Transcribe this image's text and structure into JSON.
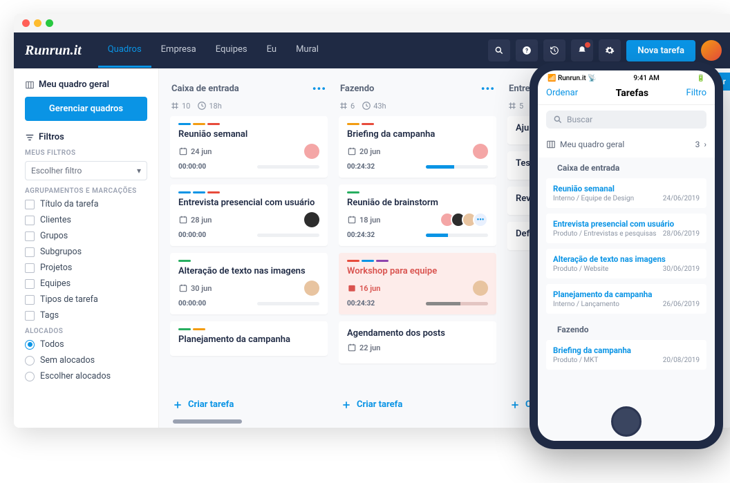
{
  "brand": "Runrun.it",
  "nav": {
    "items": [
      "Quadros",
      "Empresa",
      "Equipes",
      "Eu",
      "Mural"
    ],
    "active": 0,
    "new_task": "Nova tarefa"
  },
  "sidebar": {
    "board_title": "Meu quadro geral",
    "manage": "Gerenciar quadros",
    "filters_label": "Filtros",
    "my_filters_label": "MEUS FILTROS",
    "filter_placeholder": "Escolher filtro",
    "groups_label": "AGRUPAMENTOS E MARCAÇÕES",
    "group_items": [
      "Título da tarefa",
      "Clientes",
      "Grupos",
      "Subgrupos",
      "Projetos",
      "Equipes",
      "Tipos de tarefa",
      "Tags"
    ],
    "alloc_label": "ALOCADOS",
    "alloc_items": [
      "Todos",
      "Sem alocados",
      "Escolher alocados"
    ],
    "alloc_active": 0
  },
  "board": {
    "create_label": "Criar tarefa",
    "create_top": "Criar r",
    "columns": [
      {
        "title": "Caixa de entrada",
        "count": 10,
        "hours": "18h",
        "cards": [
          {
            "tags": [
              "#0a94e5",
              "#f39c12",
              "#e74c3c"
            ],
            "title": "Reunião semanal",
            "date": "24 jun",
            "time": "00:00:00",
            "progress": 0,
            "avatars": 1
          },
          {
            "tags": [
              "#0a94e5",
              "#0a94e5",
              "#e74c3c"
            ],
            "title": "Entrevista presencial com usuário",
            "date": "28 jun",
            "time": "00:00:00",
            "progress": 0,
            "avatars": 1
          },
          {
            "tags": [
              "#27ae60"
            ],
            "title": "Alteração de texto nas imagens",
            "date": "30 jun",
            "time": "00:00:00",
            "progress": 0,
            "avatars": 1
          },
          {
            "tags": [
              "#27ae60",
              "#f39c12"
            ],
            "title": "Planejamento da campanha",
            "date": "",
            "time": "",
            "progress": 0,
            "avatars": 0
          }
        ]
      },
      {
        "title": "Fazendo",
        "count": 6,
        "hours": "43h",
        "cards": [
          {
            "tags": [
              "#f39c12",
              "#e74c3c"
            ],
            "title": "Briefing da campanha",
            "date": "20 jun",
            "time": "00:24:32",
            "progress": 45,
            "avatars": 1
          },
          {
            "tags": [
              "#27ae60"
            ],
            "title": "Reunião de brainstorm",
            "date": "18 jun",
            "time": "00:24:32",
            "progress": 35,
            "avatars": 4
          },
          {
            "tags": [
              "#e74c3c",
              "#0a94e5",
              "#8e44ad"
            ],
            "title": "Workshop para equipe",
            "date": "16 jun",
            "time": "00:24:32",
            "progress": 55,
            "avatars": 1,
            "urgent": true
          },
          {
            "tags": [],
            "title": "Agendamento dos posts",
            "date": "22 jun",
            "time": "",
            "progress": 0,
            "avatars": 0
          }
        ]
      },
      {
        "title": "Entre",
        "count": 5,
        "hours": "",
        "cards": [
          {
            "tags": [],
            "title": "Aju",
            "date": "",
            "time": "",
            "progress": 0,
            "avatars": 0
          },
          {
            "tags": [],
            "title": "Tes",
            "date": "",
            "time": "",
            "progress": 0,
            "avatars": 0
          },
          {
            "tags": [],
            "title": "Rev",
            "date": "",
            "time": "",
            "progress": 0,
            "avatars": 0
          },
          {
            "tags": [],
            "title": "Def",
            "date": "",
            "time": "",
            "progress": 0,
            "avatars": 0
          }
        ]
      }
    ]
  },
  "phone": {
    "carrier": "Runrun.it",
    "time": "9:41 AM",
    "nav": {
      "left": "Ordenar",
      "title": "Tarefas",
      "right": "Filtro"
    },
    "search_placeholder": "Buscar",
    "board_name": "Meu quadro geral",
    "board_count": "3",
    "sections": [
      {
        "title": "Caixa de entrada",
        "tasks": [
          {
            "title": "Reunião semanal",
            "meta": "Interno / Equipe de Design",
            "date": "24/06/2019"
          },
          {
            "title": "Entrevista presencial com usuário",
            "meta": "Produto / Entrevistas e pesquisas",
            "date": "28/06/2019"
          },
          {
            "title": "Alteração de texto nas imagens",
            "meta": "Produto / Website",
            "date": "30/06/2019"
          },
          {
            "title": "Planejamento da campanha",
            "meta": "Interno / Lançamento",
            "date": "26/06/2019"
          }
        ]
      },
      {
        "title": "Fazendo",
        "tasks": [
          {
            "title": "Briefing da campanha",
            "meta": "Produto / MKT",
            "date": "20/08/2019"
          }
        ]
      }
    ]
  }
}
